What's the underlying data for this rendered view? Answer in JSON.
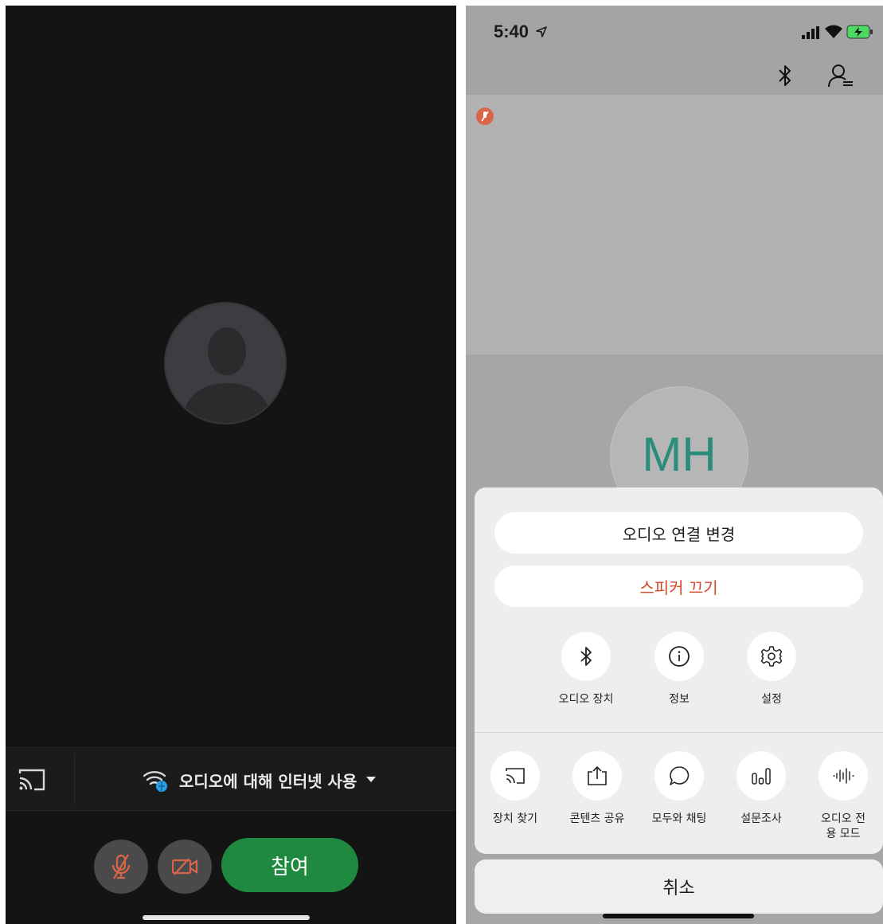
{
  "left_screen": {
    "audio_option_label": "오디오에 대해 인터넷 사용",
    "join_label": "참여",
    "icons": [
      "cast-icon",
      "wifi-globe-icon",
      "caret-down-icon",
      "mic-muted-icon",
      "video-off-icon",
      "avatar-silhouette-icon"
    ]
  },
  "right_screen": {
    "status_time": "5:40",
    "avatar_initials": "MH",
    "sheet": {
      "change_audio_label": "오디오 연결 변경",
      "speaker_off_label": "스피커 끄기",
      "options_row1": [
        {
          "label": "오디오 장치",
          "icon": "bluetooth-icon"
        },
        {
          "label": "정보",
          "icon": "info-icon"
        },
        {
          "label": "설정",
          "icon": "settings-icon"
        }
      ],
      "options_row2": [
        {
          "label": "장치 찾기",
          "icon": "cast-icon"
        },
        {
          "label": "콘텐츠 공유",
          "icon": "share-icon"
        },
        {
          "label": "모두와 채팅",
          "icon": "chat-icon"
        },
        {
          "label": "설문조사",
          "icon": "poll-icon"
        },
        {
          "label": "오디오 전\n용 모드",
          "icon": "audio-only-icon"
        }
      ],
      "cancel_label": "취소"
    },
    "colors": {
      "accent_red": "#d24a2a",
      "initials_teal": "#2a8c7a",
      "join_green": "#1f8a3f"
    }
  }
}
